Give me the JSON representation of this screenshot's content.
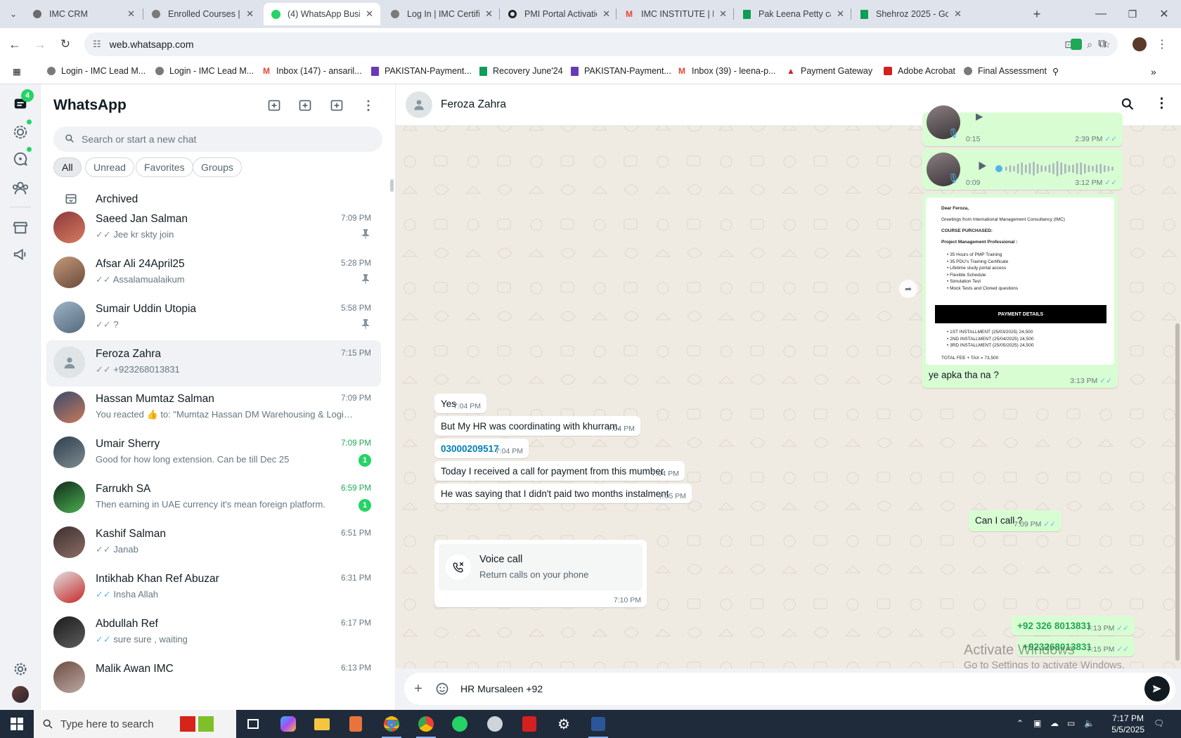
{
  "browser": {
    "tabs": [
      {
        "title": "IMC CRM",
        "icon": "imc-crm-icon"
      },
      {
        "title": "Enrolled Courses | IMC",
        "icon": "imc-icon"
      },
      {
        "title": "(4) WhatsApp Business",
        "icon": "whatsapp-icon",
        "active": true
      },
      {
        "title": "Log In | IMC Certific",
        "icon": "imc-icon"
      },
      {
        "title": "PMI Portal Activation",
        "icon": "pmi-icon"
      },
      {
        "title": "IMC INSTITUTE | EN",
        "icon": "gmail-icon"
      },
      {
        "title": "Pak Leena Petty cas",
        "icon": "sheets-icon"
      },
      {
        "title": "Shehroz 2025 - Goo",
        "icon": "sheets-icon"
      }
    ],
    "url": "web.whatsapp.com",
    "bookmarks": [
      {
        "label": "Login - IMC Lead M...",
        "icon": "imc-icon"
      },
      {
        "label": "Login - IMC Lead M...",
        "icon": "imc-icon"
      },
      {
        "label": "Inbox (147) - ansaril...",
        "icon": "gmail-icon"
      },
      {
        "label": "PAKISTAN-Payment...",
        "icon": "forms-icon"
      },
      {
        "label": "Recovery June'24",
        "icon": "sheets-icon"
      },
      {
        "label": "PAKISTAN-Payment...",
        "icon": "forms-icon"
      },
      {
        "label": "Inbox (39) - leena-p...",
        "icon": "gmail-icon"
      },
      {
        "label": "Payment Gateway",
        "icon": "gateway-icon"
      },
      {
        "label": "Adobe Acrobat",
        "icon": "acrobat-icon"
      },
      {
        "label": "Final Assessment",
        "icon": "imc-icon"
      }
    ]
  },
  "whatsapp": {
    "rail_badge": "4",
    "title": "WhatsApp",
    "search_placeholder": "Search or start a new chat",
    "filters": [
      "All",
      "Unread",
      "Favorites",
      "Groups"
    ],
    "archived_label": "Archived",
    "chats": [
      {
        "name": "Saeed Jan Salman",
        "preview": "Jee kr skty join",
        "time": "7:09 PM",
        "tick": "grey",
        "pinned": true
      },
      {
        "name": "Afsar Ali 24April25",
        "preview": "Assalamualaikum",
        "time": "5:28 PM",
        "tick": "grey",
        "pinned": true
      },
      {
        "name": "Sumair Uddin Utopia",
        "preview": "?",
        "time": "5:58 PM",
        "tick": "grey",
        "pinned": true
      },
      {
        "name": "Feroza Zahra",
        "preview": "+923268013831",
        "time": "7:15 PM",
        "tick": "grey",
        "selected": true
      },
      {
        "name": "Hassan Mumtaz Salman",
        "preview": "You reacted 👍 to: \"Mumtaz Hassan DM Warehousing & Logistics T...",
        "time": "7:09 PM"
      },
      {
        "name": "Umair Sherry",
        "preview": "Good for how long extension. Can be till Dec 25",
        "time": "7:09 PM",
        "unread": "1",
        "time_green": true
      },
      {
        "name": "Farrukh SA",
        "preview": "Then earning in UAE currency it's mean foreign platform.",
        "time": "6:59 PM",
        "unread": "1",
        "time_green": true
      },
      {
        "name": "Kashif Salman",
        "preview": "Janab",
        "time": "6:51 PM",
        "tick": "grey"
      },
      {
        "name": "Intikhab Khan Ref Abuzar",
        "preview": "Insha Allah",
        "time": "6:31 PM",
        "tick": "blue"
      },
      {
        "name": "Abdullah Ref",
        "preview": "sure sure , waiting",
        "time": "6:17 PM",
        "tick": "blue"
      },
      {
        "name": "Malik Awan IMC",
        "preview": "",
        "time": "6:13 PM"
      }
    ],
    "conversation": {
      "contact": "Feroza Zahra",
      "audio": [
        {
          "duration": "0:15",
          "time": "2:39 PM"
        },
        {
          "duration": "0:09",
          "time": "3:12 PM"
        }
      ],
      "document": {
        "greeting": "Dear Feroza,",
        "line1": "Greetings from International Management Consultancy (IMC)",
        "course_label": "COURSE PURCHASED:",
        "course": "Project Management Professional :",
        "bullets": [
          "35 Hours of PMP Training",
          "35 PDU's Training Certificate",
          "Lifetime study portal access",
          "Flexible Schedule",
          "Simulation Test",
          "Mock Tests and Cloned questions"
        ],
        "payment_header": "PAYMENT DETAILS",
        "installments": [
          "1ST  INSTALLMENT  (25/03/2025)   24,500",
          "2ND  INSTALLMENT (25/04/2025)   24,500",
          "3RD  INSTALLMENT (25/05/2025)   24,500"
        ],
        "total": "TOTAL FEE + TAX  = 73,500",
        "caption": "ye apka tha na ?",
        "time": "3:13 PM"
      },
      "incoming": [
        {
          "text": "Yes",
          "time": "7:04 PM"
        },
        {
          "text": "But My HR was coordinating with khurram.",
          "time": "7:04 PM"
        },
        {
          "text": "03000209517",
          "time": "7:04 PM",
          "link": true
        },
        {
          "text": "Today I received a call for payment from this mumber",
          "time": "7:04 PM"
        },
        {
          "text": "He was saying that I didn't paid two months instalment",
          "time": "7:05 PM"
        }
      ],
      "outgoing_call_q": {
        "text": "Can I call ?",
        "time": "7:09 PM"
      },
      "voice_call": {
        "title": "Voice call",
        "subtitle": "Return calls on your phone",
        "time": "7:10 PM"
      },
      "outgoing_numbers": [
        {
          "text": "+92 326 8013831",
          "time": "7:13 PM"
        },
        {
          "text": "+923268013831",
          "time": "7:15 PM"
        }
      ],
      "composer_value": "HR Mursaleen +92"
    }
  },
  "windows": {
    "activate_title": "Activate Windows",
    "activate_sub": "Go to Settings to activate Windows.",
    "search_placeholder": "Type here to search",
    "time": "7:17 PM",
    "date": "5/5/2025"
  }
}
